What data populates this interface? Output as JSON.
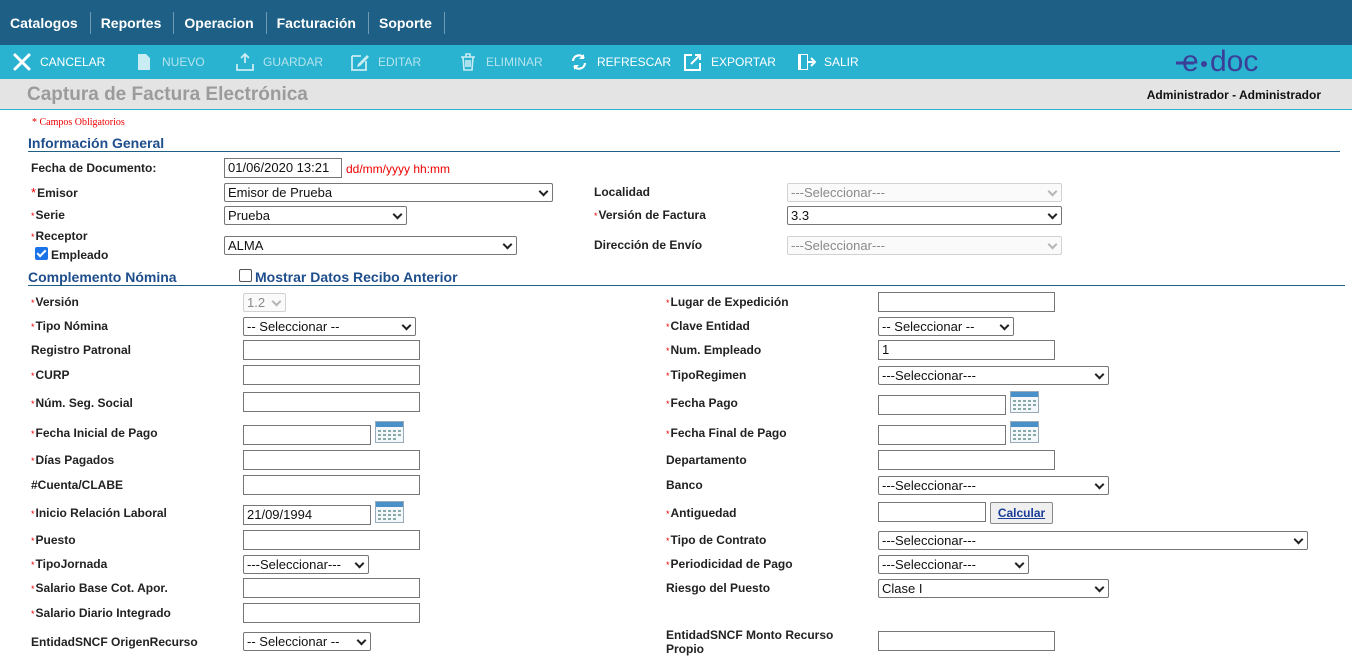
{
  "menu": [
    "Catalogos",
    "Reportes",
    "Operacion",
    "Facturación",
    "Soporte"
  ],
  "toolbar": {
    "cancelar": "CANCELAR",
    "nuevo": "NUEVO",
    "guardar": "GUARDAR",
    "editar": "EDITAR",
    "eliminar": "ELIMINAR",
    "refrescar": "REFRESCAR",
    "exportar": "EXPORTAR",
    "salir": "SALIR"
  },
  "logo_text": "e·doc",
  "title": "Captura de Factura Electrónica",
  "user": "Administrador - Administrador",
  "required_note": "* Campos Obligatorios",
  "general": {
    "heading": "Información General",
    "fecha_label": "Fecha de Documento:",
    "fecha_value": "01/06/2020 13:21",
    "fecha_hint": "dd/mm/yyyy hh:mm",
    "emisor_label": "Emisor",
    "emisor_value": "Emisor de Prueba",
    "serie_label": "Serie",
    "serie_value": "Prueba",
    "receptor_label": "Receptor",
    "empleado_label": "Empleado",
    "receptor_value": "ALMA",
    "localidad_label": "Localidad",
    "localidad_value": "---Seleccionar---",
    "version_factura_label": "Versión de Factura",
    "version_factura_value": "3.3",
    "direccion_label": "Dirección de Envío",
    "direccion_value": "---Seleccionar---"
  },
  "nomina": {
    "heading": "Complemento Nómina",
    "mostrar_label": "Mostrar Datos Recibo Anterior",
    "version_label": "Versión",
    "version_value": "1.2",
    "tipo_nomina_label": "Tipo Nómina",
    "tipo_nomina_value": "-- Seleccionar --",
    "registro_patronal_label": "Registro Patronal",
    "curp_label": "CURP",
    "nss_label": "Núm. Seg. Social",
    "fecha_inicial_label": "Fecha Inicial de Pago",
    "dias_pagados_label": "Días Pagados",
    "cuenta_label": "#Cuenta/CLABE",
    "inicio_relacion_label": "Inicio Relación Laboral",
    "inicio_relacion_value": "21/09/1994",
    "puesto_label": "Puesto",
    "tipo_jornada_label": "TipoJornada",
    "tipo_jornada_value": "---Seleccionar---",
    "salario_base_label": "Salario Base Cot. Apor.",
    "salario_diario_label": "Salario Diario Integrado",
    "entidad_origen_label": "EntidadSNCF OrigenRecurso",
    "entidad_origen_value": "-- Seleccionar --",
    "lugar_expedicion_label": "Lugar de Expedición",
    "clave_entidad_label": "Clave Entidad",
    "clave_entidad_value": "-- Seleccionar --",
    "num_empleado_label": "Num. Empleado",
    "num_empleado_value": "1",
    "tipo_regimen_label": "TipoRegimen",
    "tipo_regimen_value": "---Seleccionar---",
    "fecha_pago_label": "Fecha Pago",
    "fecha_final_label": "Fecha Final de Pago",
    "departamento_label": "Departamento",
    "banco_label": "Banco",
    "banco_value": "---Seleccionar---",
    "antiguedad_label": "Antiguedad",
    "calcular_label": "Calcular",
    "tipo_contrato_label": "Tipo de Contrato",
    "tipo_contrato_value": "---Seleccionar---",
    "periodicidad_label": "Periodicidad de Pago",
    "periodicidad_value": "---Seleccionar---",
    "riesgo_label": "Riesgo del Puesto",
    "riesgo_value": "Clase I",
    "monto_recurso_label_1": "EntidadSNCF Monto Recurso",
    "monto_recurso_label_2": "Propio"
  },
  "colors": {
    "menubar": "#1e5f85",
    "toolbar": "#29b3d0",
    "section_heading": "#1e4e8c",
    "required": "#e00000"
  }
}
